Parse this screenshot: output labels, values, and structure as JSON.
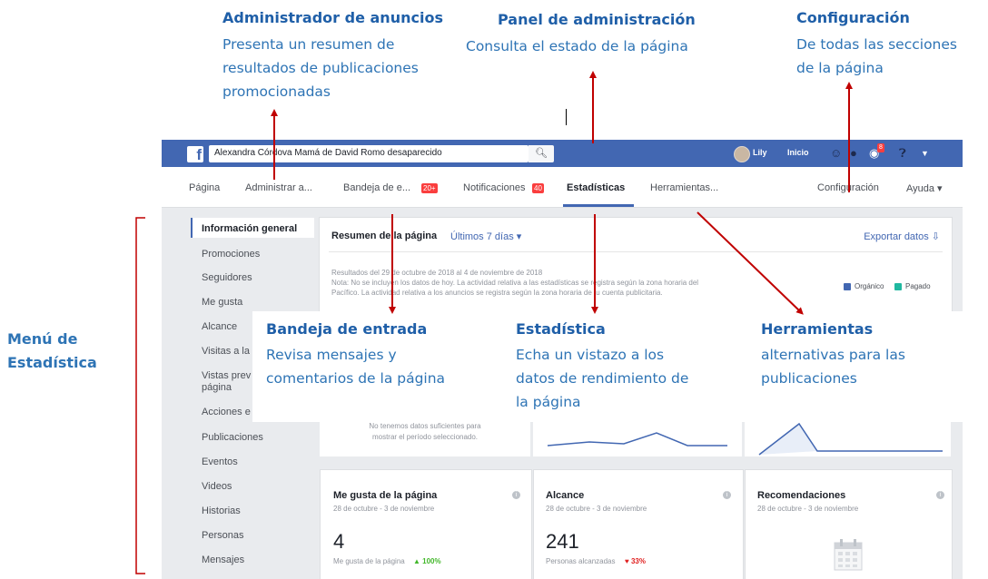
{
  "callouts": {
    "ads_manager": {
      "title": "Administrador de anuncios",
      "lines": [
        "Presenta un resumen de",
        "resultados de publicaciones",
        "promocionadas"
      ]
    },
    "admin_panel": {
      "title": "Panel de administración",
      "lines": [
        "Consulta el estado de la página"
      ]
    },
    "settings": {
      "title": "Configuración",
      "lines": [
        "De todas las secciones",
        "de la página"
      ]
    },
    "inbox": {
      "title": "Bandeja de entrada",
      "lines": [
        "Revisa mensajes y",
        "comentarios de la página"
      ]
    },
    "stats": {
      "title": "Estadística",
      "lines": [
        "Echa un vistazo a los",
        "datos de rendimiento de",
        "la página"
      ]
    },
    "tools": {
      "title": "Herramientas",
      "lines": [
        "alternativas para las",
        "publicaciones"
      ]
    },
    "stats_menu": {
      "lines": [
        "Menú de",
        "Estadística"
      ]
    }
  },
  "topbar": {
    "search_value": "Alexandra Córdova Mamá de David Romo desaparecido",
    "user_name": "Lily",
    "home_label": "Inicio",
    "notifications_badge": "8"
  },
  "page_nav": {
    "items": [
      "Página",
      "Administrar a...",
      "Bandeja de e...",
      "Notificaciones",
      "Estadísticas",
      "Herramientas...",
      "Configuración",
      "Ayuda ▾"
    ],
    "inbox_badge": "20+",
    "notifications_badge": "40"
  },
  "sidebar": {
    "items": [
      "Información general",
      "Promociones",
      "Seguidores",
      "Me gusta",
      "Alcance",
      "Visitas a la",
      "Vistas prev",
      "página",
      "Acciones e",
      "Publicaciones",
      "Eventos",
      "Videos",
      "Historias",
      "Personas",
      "Mensajes"
    ]
  },
  "summary": {
    "title": "Resumen de la página",
    "range": "Últimos 7 días ▾",
    "export": "Exportar datos ⇩",
    "results": "Resultados del 29 de octubre de 2018 al 4 de noviembre de 2018",
    "note_lines": [
      "Nota: No se incluyen los datos de hoy. La actividad relativa a las estadísticas se registra según la zona horaria del",
      "Pacífico. La actividad relativa a los anuncios se registra según la zona horaria de tu cuenta publicitaria."
    ],
    "legend_organic": "Orgánico",
    "legend_paid": "Pagado",
    "no_data_lines": [
      "No tenemos datos suficientes para",
      "mostrar el período seleccionado."
    ]
  },
  "metrics": [
    {
      "title": "Me gusta de la página",
      "range": "28 de octubre - 3 de noviembre",
      "value": "4",
      "caption": "Me gusta de la página",
      "change": "▲ 100%"
    },
    {
      "title": "Alcance",
      "range": "28 de octubre - 3 de noviembre",
      "value": "241",
      "caption": "Personas alcanzadas",
      "change": "♥ 33%"
    },
    {
      "title": "Recomendaciones",
      "range": "28 de octubre - 3 de noviembre"
    }
  ],
  "colors": {
    "facebook_blue": "#4267b2",
    "callout_blue": "#2e74b5",
    "arrow_red": "#c00000",
    "organic": "#4267b2",
    "paid": "#20b8a0"
  }
}
